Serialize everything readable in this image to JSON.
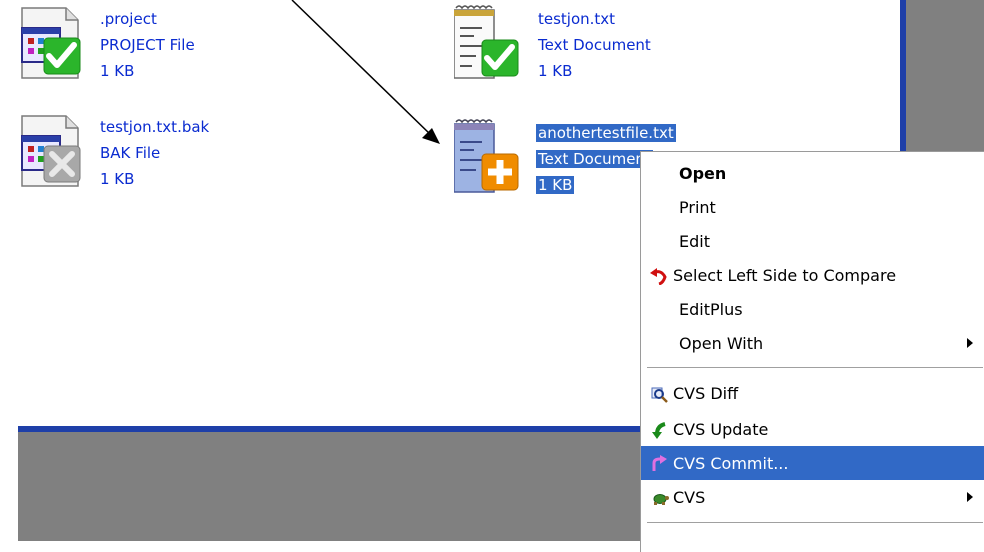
{
  "files": [
    {
      "name": ".project",
      "type": "PROJECT File",
      "size": "1 KB",
      "overlay": "checkmark-icon",
      "kind": "project"
    },
    {
      "name": "testjon.txt",
      "type": "Text Document",
      "size": "1 KB",
      "overlay": "checkmark-icon",
      "kind": "text"
    },
    {
      "name": "testjon.txt.bak",
      "type": "BAK File",
      "size": "1 KB",
      "overlay": "ignored-x-icon",
      "kind": "project"
    },
    {
      "name": "anothertestfile.txt",
      "type": "Text Document",
      "size": "1 KB",
      "overlay": "added-plus-icon",
      "kind": "text",
      "selected": true
    }
  ],
  "context_menu": {
    "items": [
      {
        "label": "Open",
        "bold": true
      },
      {
        "label": "Print"
      },
      {
        "label": "Edit"
      },
      {
        "label": "Select Left Side to Compare",
        "icon": "undo-arrow-icon"
      },
      {
        "label": "EditPlus"
      },
      {
        "label": "Open With",
        "submenu": true
      },
      {
        "label": "CVS Diff",
        "icon": "magnifier-icon"
      },
      {
        "label": "CVS Update",
        "icon": "green-arrow-icon"
      },
      {
        "label": "CVS Commit...",
        "icon": "pink-arrow-icon",
        "highlighted": true
      },
      {
        "label": "CVS",
        "icon": "turtle-icon",
        "submenu": true
      }
    ]
  },
  "colors": {
    "link_blue": "#0a2bd0",
    "selection_blue": "#3169c6",
    "gray": "#808080",
    "check_green": "#2bb52b",
    "plus_orange": "#f08c00"
  }
}
